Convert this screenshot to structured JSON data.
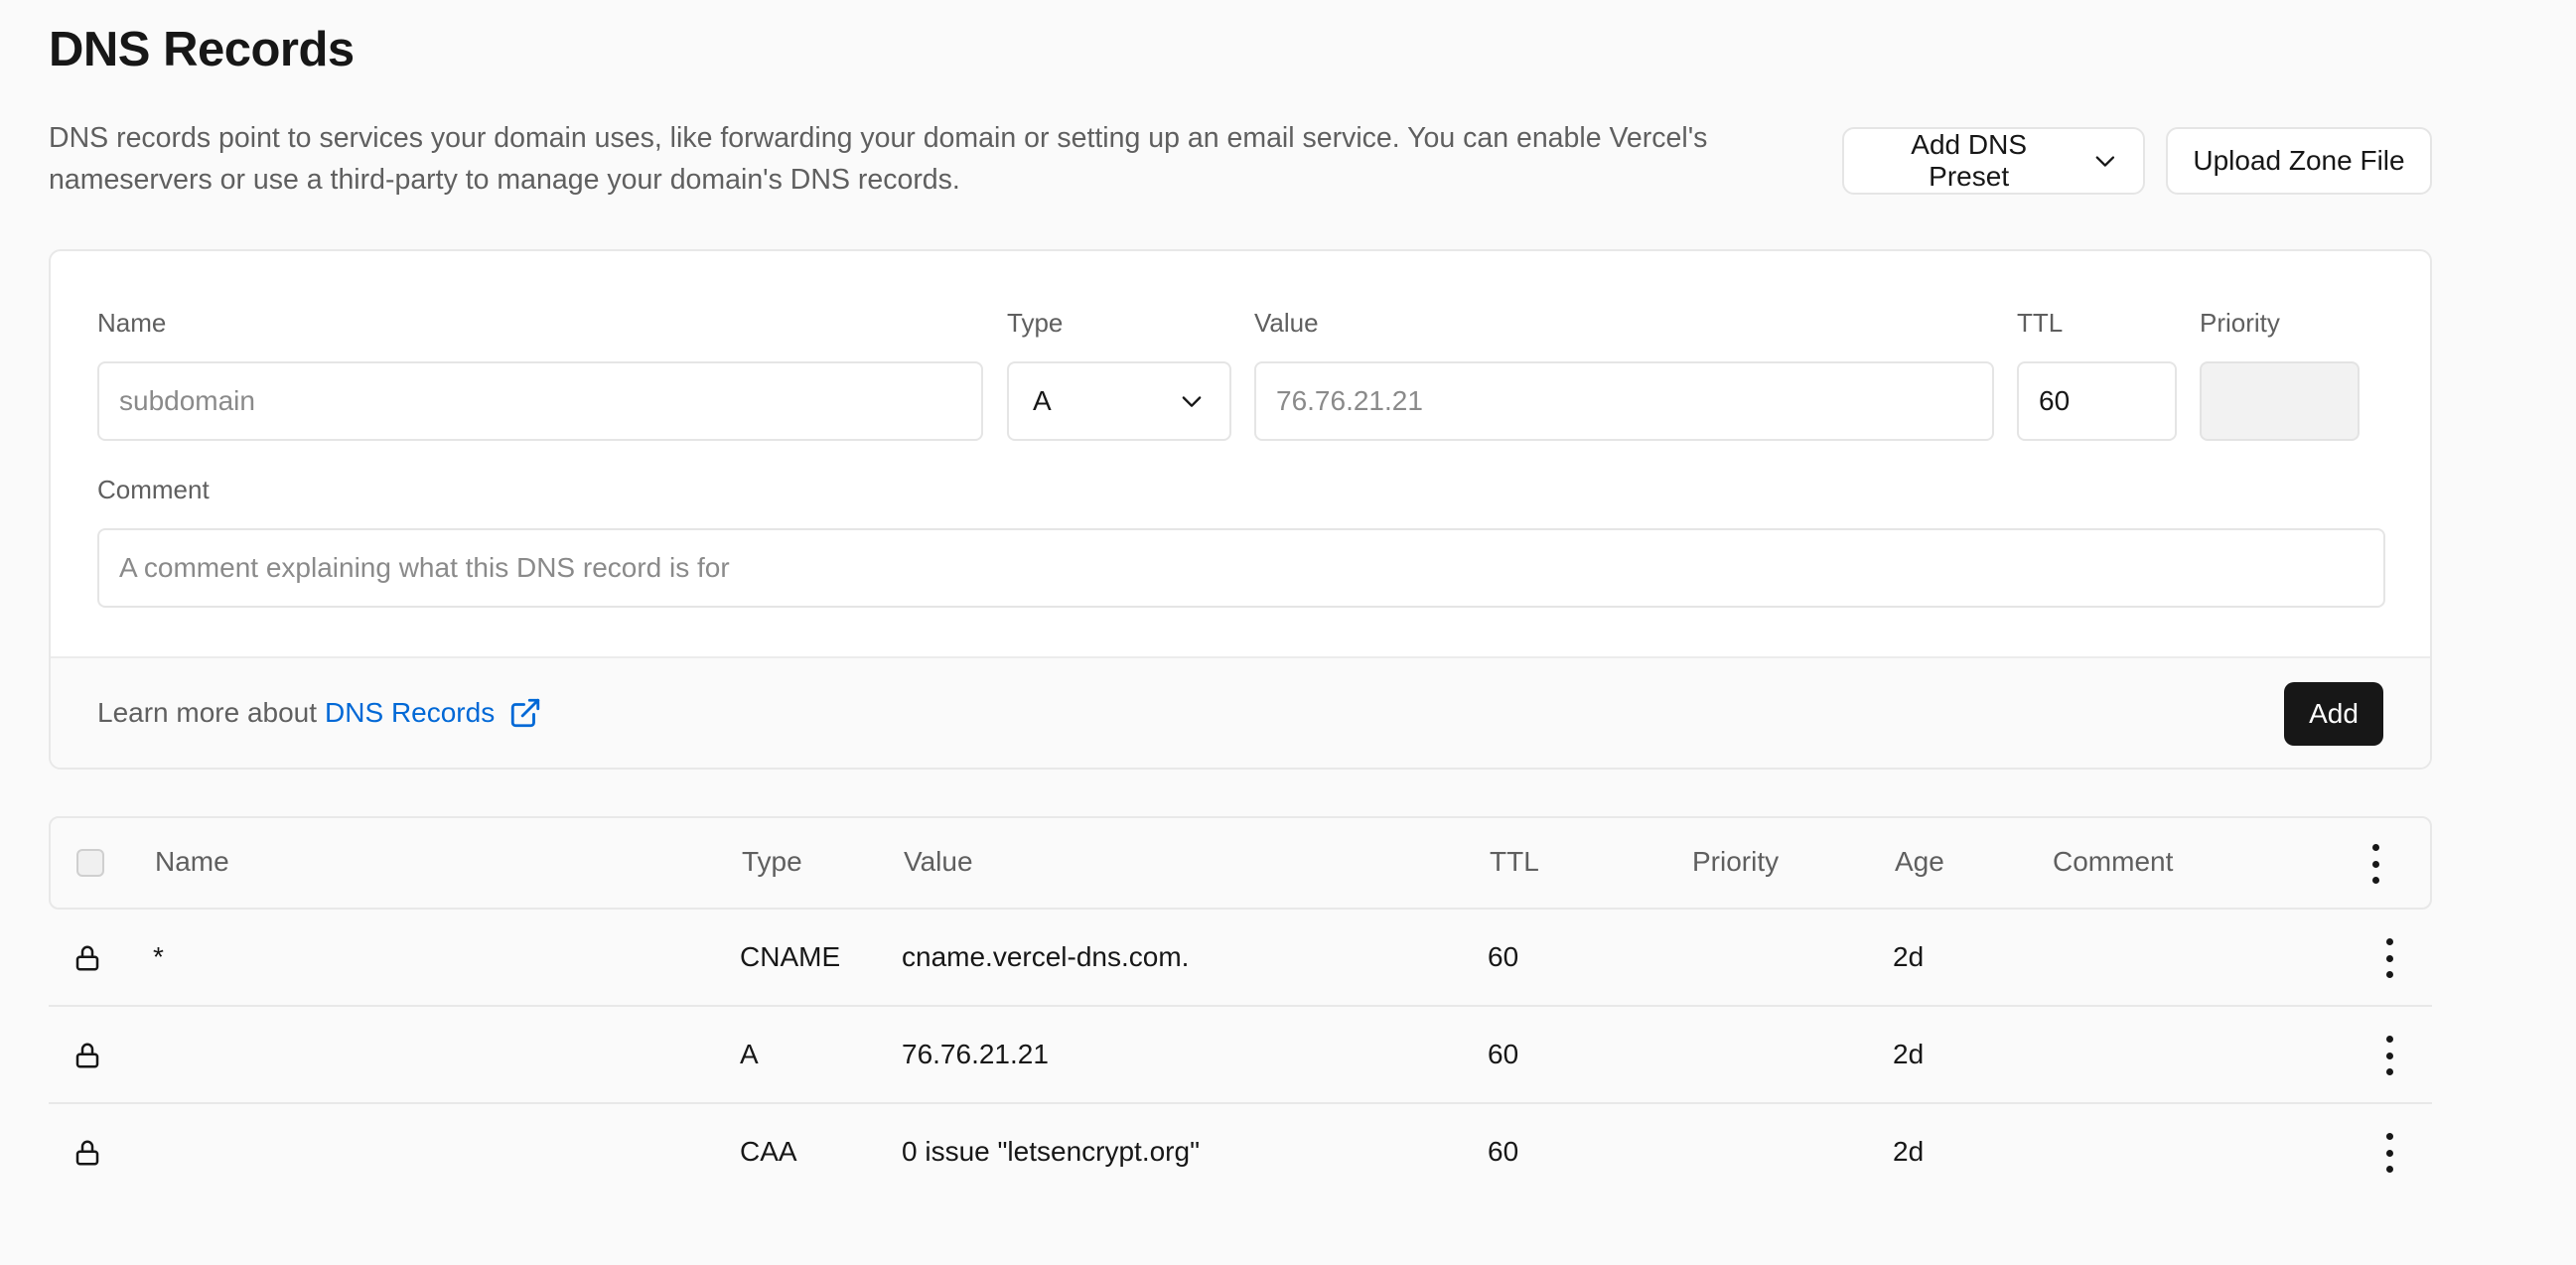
{
  "page": {
    "title": "DNS Records",
    "description": "DNS records point to services your domain uses, like forwarding your domain or setting up an email service. You can enable Vercel's nameservers or use a third-party to manage your domain's DNS records."
  },
  "actions": {
    "preset_label": "Add DNS Preset",
    "upload_label": "Upload Zone File"
  },
  "form": {
    "name_label": "Name",
    "name_placeholder": "subdomain",
    "type_label": "Type",
    "type_value": "A",
    "value_label": "Value",
    "value_placeholder": "76.76.21.21",
    "ttl_label": "TTL",
    "ttl_value": "60",
    "priority_label": "Priority",
    "comment_label": "Comment",
    "comment_placeholder": "A comment explaining what this DNS record is for",
    "learn_prefix": "Learn more about",
    "learn_link": "DNS Records",
    "add_label": "Add"
  },
  "table": {
    "columns": [
      "Name",
      "Type",
      "Value",
      "TTL",
      "Priority",
      "Age",
      "Comment"
    ],
    "rows": [
      {
        "name": "*",
        "type": "CNAME",
        "value": "cname.vercel-dns.com.",
        "ttl": "60",
        "priority": "",
        "age": "2d",
        "comment": ""
      },
      {
        "name": "",
        "type": "A",
        "value": "76.76.21.21",
        "ttl": "60",
        "priority": "",
        "age": "2d",
        "comment": ""
      },
      {
        "name": "",
        "type": "CAA",
        "value": "0 issue \"letsencrypt.org\"",
        "ttl": "60",
        "priority": "",
        "age": "2d",
        "comment": ""
      }
    ]
  },
  "colors": {
    "link": "#0068d6",
    "primary_button": "#171717",
    "background": "#fafafa"
  }
}
